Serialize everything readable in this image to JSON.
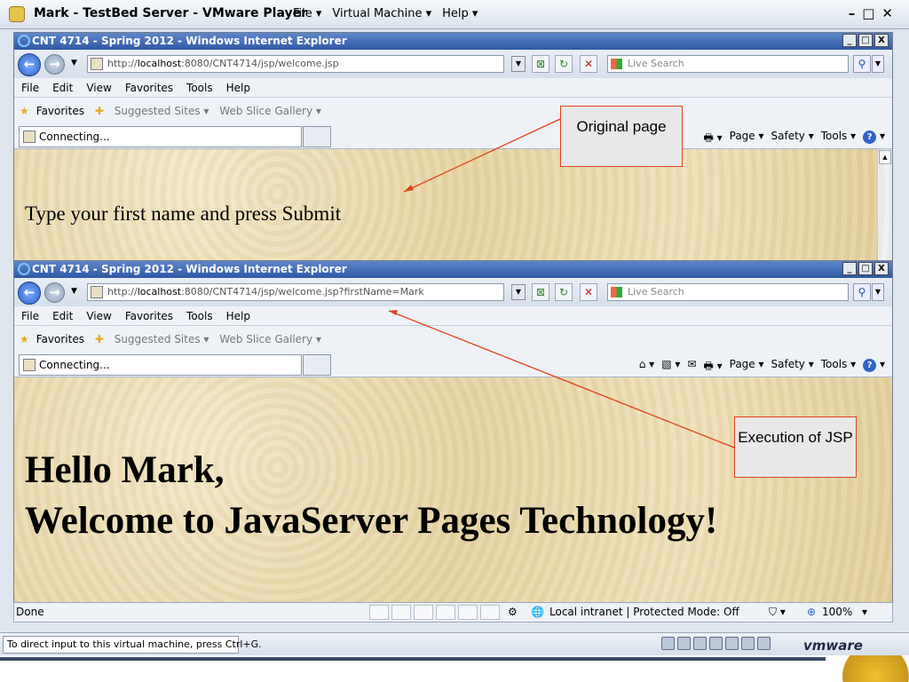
{
  "vmware": {
    "title": "Mark - TestBed Server - VMware Player",
    "menu": [
      "File ▾",
      "Virtual Machine ▾",
      "Help ▾"
    ],
    "window_controls": "–□✕",
    "status_hint": "To direct input to this virtual machine, press Ctrl+G.",
    "logo": "vmware"
  },
  "ie_top": {
    "title": "CNT 4714 - Spring 2012 - Windows Internet Explorer",
    "url_prefix": "http://",
    "url_host": "localhost",
    "url_rest": ":8080/CNT4714/jsp/welcome.jsp",
    "search_placeholder": "Live Search",
    "menu": [
      "File",
      "Edit",
      "View",
      "Favorites",
      "Tools",
      "Help"
    ],
    "favorites": "Favorites",
    "suggested": "Suggested Sites ▾",
    "webslice": "Web Slice Gallery ▾",
    "tab_label": "Connecting...",
    "cmd": [
      "Page ▾",
      "Safety ▾",
      "Tools ▾"
    ],
    "page_text": "Type your first name and press Submit"
  },
  "ie_bottom": {
    "title": "CNT 4714 - Spring 2012 - Windows Internet Explorer",
    "url_prefix": "http://",
    "url_host": "localhost",
    "url_rest": ":8080/CNT4714/jsp/welcome.jsp?firstName=Mark",
    "search_placeholder": "Live Search",
    "menu": [
      "File",
      "Edit",
      "View",
      "Favorites",
      "Tools",
      "Help"
    ],
    "favorites": "Favorites",
    "suggested": "Suggested Sites ▾",
    "webslice": "Web Slice Gallery ▾",
    "tab_label": "Connecting...",
    "cmd": [
      "Page ▾",
      "Safety ▾",
      "Tools ▾"
    ],
    "heading_line1": "Hello Mark,",
    "heading_line2": "Welcome to JavaServer Pages Technology!",
    "status_left": "Done",
    "status_zone": "Local intranet | Protected Mode: Off",
    "zoom": "100%"
  },
  "annotations": {
    "original": "Original page",
    "execution": "Execution of JSP",
    "color": "#e0421b"
  }
}
